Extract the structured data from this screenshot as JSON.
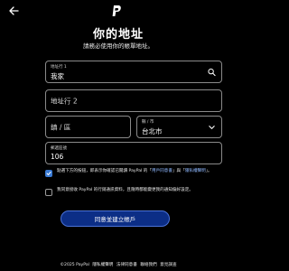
{
  "header": {
    "back_icon": "arrow-left-icon",
    "logo_icon": "paypal-logo-icon"
  },
  "page": {
    "title": "你的地址",
    "subtitle": "請務必使用你的帳單地址。"
  },
  "form": {
    "address1": {
      "label": "地址行 1",
      "value": "我家",
      "icon": "search-icon"
    },
    "address2": {
      "placeholder": "地址行 2"
    },
    "district": {
      "placeholder": "鎮 / 區"
    },
    "city": {
      "label": "縣 / 市",
      "value": "台北市",
      "icon": "chevron-down-icon"
    },
    "postal": {
      "label": "郵遞區號",
      "value": "106"
    }
  },
  "consents": [
    {
      "checked": true,
      "text_before": "點選下方的按鈕，即表示你確認已閱讀 PayPal 的「",
      "link1": "用戶同意書",
      "text_mid": "」與「",
      "link2": "隱私權聲明",
      "text_after": "」。"
    },
    {
      "checked": false,
      "text": "我同意接收 PayPal 的行銷通訊資料，且隨時都能變更我的通知偏好設定。"
    }
  ],
  "cta": {
    "label": "同意並建立帳戶"
  },
  "footer": {
    "copyright": "©2025 PayPal",
    "links": [
      "隱私權聲明",
      "法律同意書",
      "聯絡我們",
      "意見調查"
    ]
  },
  "colors": {
    "background": "#000000",
    "cta_background": "#0c2e86",
    "checkbox_checked": "#3a7bd5",
    "link": "#8fb8ff"
  }
}
